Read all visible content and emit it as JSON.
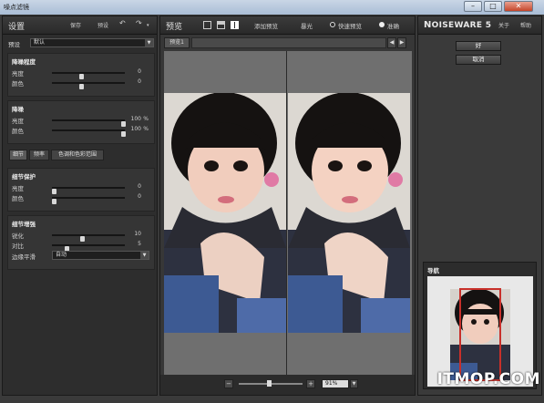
{
  "window": {
    "title": "噪点滤镜"
  },
  "left": {
    "title": "设置",
    "save_label": "保存",
    "preset_btn": "预设",
    "preset_label": "预设",
    "preset_value": "默认",
    "sections": [
      {
        "title": "降噪程度",
        "rows": [
          {
            "label": "亮度",
            "value": "0",
            "pos": 0.42
          },
          {
            "label": "颜色",
            "value": "0",
            "pos": 0.42
          }
        ]
      },
      {
        "title": "降噪",
        "rows": [
          {
            "label": "亮度",
            "value": "100",
            "unit": "%",
            "pos": 0.98
          },
          {
            "label": "颜色",
            "value": "100",
            "unit": "%",
            "pos": 0.98
          }
        ]
      }
    ],
    "tabs": [
      "细节",
      "频率",
      "色调和色彩范围"
    ],
    "detail_protect": {
      "title": "细节保护",
      "rows": [
        {
          "label": "亮度",
          "value": "0",
          "pos": 0.0
        },
        {
          "label": "颜色",
          "value": "0",
          "pos": 0.0
        }
      ]
    },
    "detail_enhance": {
      "title": "细节增强",
      "rows": [
        {
          "label": "锐化",
          "value": "10",
          "pos": 0.42
        },
        {
          "label": "对比",
          "value": "5",
          "pos": 0.22
        }
      ],
      "edge_label": "边缘平滑",
      "edge_value": "自动"
    }
  },
  "mid": {
    "title": "预览",
    "add_preview": "添加预览",
    "exposure": "暴光",
    "quick_preview": "快速预览",
    "precise": "准确",
    "preview_tab": "预览1",
    "zoom_value": "91%",
    "zoom_minus": "−",
    "zoom_plus": "+"
  },
  "right": {
    "logo_prefix": "N",
    "logo_rest": "OISEWARE",
    "logo_version": "5",
    "about": "关于",
    "help": "帮助",
    "ok": "好",
    "cancel": "取消",
    "nav_title": "导航"
  },
  "watermark": {
    "main": "ITMOP.COM",
    "sub": ""
  },
  "colors": {
    "accent": "#c8302a"
  }
}
